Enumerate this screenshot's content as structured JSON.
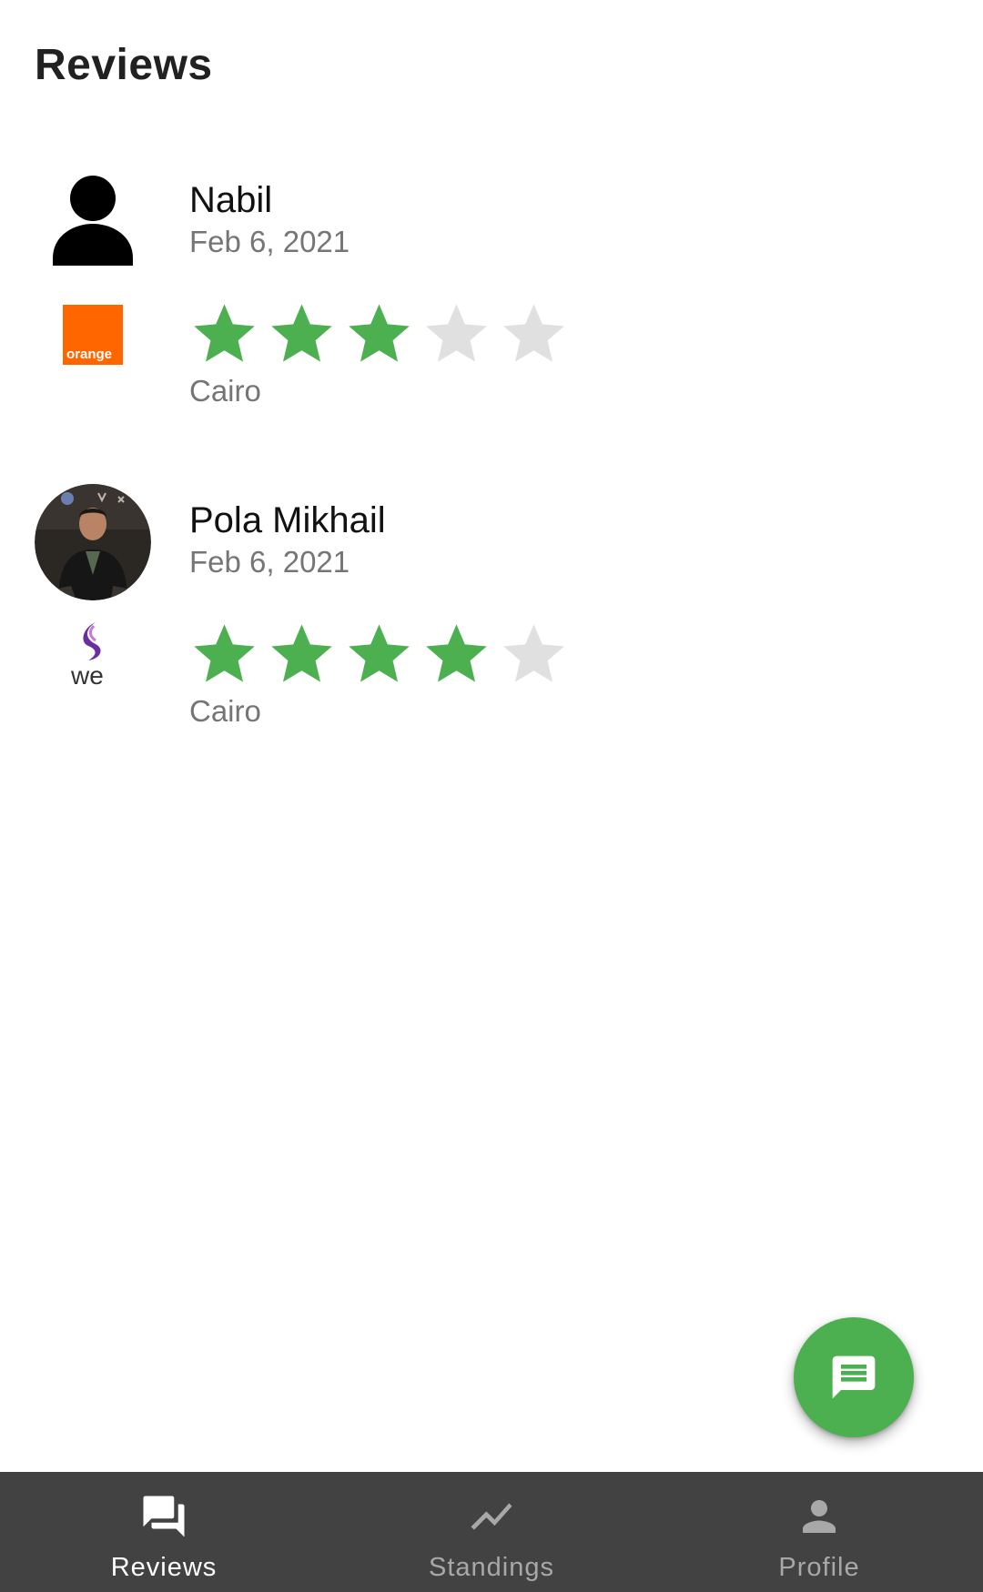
{
  "app_bar": {
    "title": "Reviews"
  },
  "reviews": [
    {
      "name": "Nabil",
      "date": "Feb 6, 2021",
      "rating": 3,
      "max_rating": 5,
      "city": "Cairo",
      "avatar": "person-silhouette-icon",
      "provider": "orange",
      "provider_logo_text": "orange"
    },
    {
      "name": "Pola Mikhail",
      "date": "Feb 6, 2021",
      "rating": 4,
      "max_rating": 5,
      "city": "Cairo",
      "avatar": "profile-photo",
      "provider": "we",
      "provider_logo_text": "we"
    }
  ],
  "fab": {
    "icon": "message-icon"
  },
  "bottom_nav": {
    "items": [
      {
        "label": "Reviews",
        "icon": "forum-icon",
        "active": true
      },
      {
        "label": "Standings",
        "icon": "trending-up-icon",
        "active": false
      },
      {
        "label": "Profile",
        "icon": "person-icon",
        "active": false
      }
    ]
  },
  "colors": {
    "accent": "#4caf50",
    "star_filled": "#4caf50",
    "star_empty": "#e0e0e0",
    "nav_background": "#424242",
    "orange_brand": "#ff6600",
    "we_brand": "#5c2d91"
  }
}
